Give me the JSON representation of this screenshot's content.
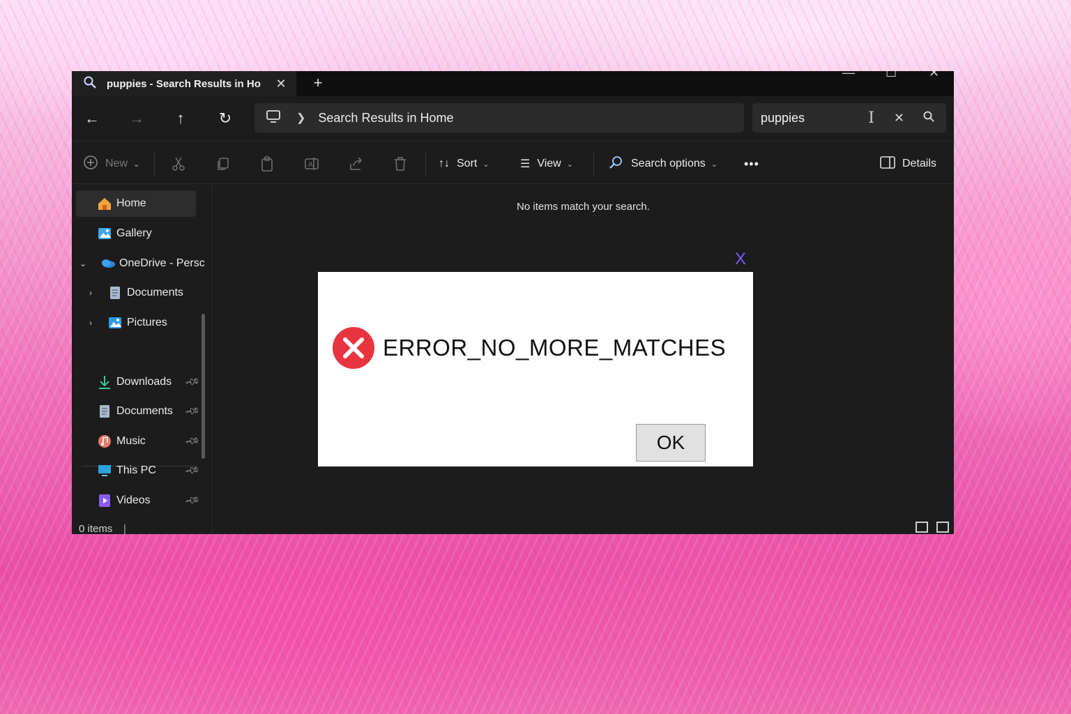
{
  "tab": {
    "title": "puppies - Search Results in Ho",
    "icon": "search-icon"
  },
  "nav": {
    "location": "Search Results in Home",
    "search_query": "puppies"
  },
  "toolbar": {
    "new_label": "New",
    "sort_label": "Sort",
    "view_label": "View",
    "search_options_label": "Search options",
    "more_label": "•••",
    "details_label": "Details"
  },
  "sidebar": {
    "items": [
      {
        "label": "Home",
        "icon": "home-icon",
        "selected": true
      },
      {
        "label": "Gallery",
        "icon": "gallery-icon"
      },
      {
        "label": "OneDrive - Persc",
        "icon": "onedrive-icon",
        "expanded": true
      },
      {
        "label": "Documents",
        "icon": "documents-icon"
      },
      {
        "label": "Pictures",
        "icon": "pictures-icon"
      },
      {
        "label": "Downloads",
        "icon": "downloads-icon",
        "pinned": true
      },
      {
        "label": "Documents",
        "icon": "documents-icon",
        "pinned": true
      },
      {
        "label": "Music",
        "icon": "music-icon",
        "pinned": true
      },
      {
        "label": "This PC",
        "icon": "this-pc-icon",
        "pinned": true
      },
      {
        "label": "Videos",
        "icon": "videos-icon",
        "pinned": true
      }
    ]
  },
  "content": {
    "empty_message": "No items match your search."
  },
  "status": {
    "item_count": "0 items",
    "separator": "|"
  },
  "dialog": {
    "close_label": "X",
    "error_code": "ERROR_NO_MORE_MATCHES",
    "ok_label": "OK",
    "error_color": "#e8343e"
  }
}
